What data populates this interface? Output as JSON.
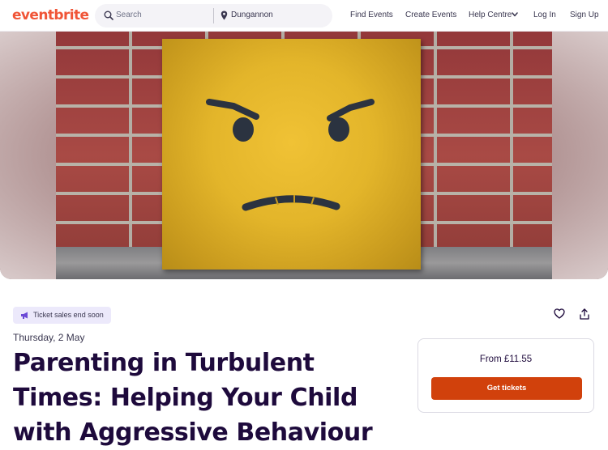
{
  "header": {
    "logo": "eventbrite",
    "search_placeholder": "Search",
    "location": "Dungannon",
    "nav": {
      "find_events": "Find Events",
      "create_events": "Create Events",
      "help_centre": "Help Centre",
      "log_in": "Log In",
      "sign_up": "Sign Up"
    }
  },
  "event": {
    "badge": "Ticket sales end soon",
    "date": "Thursday, 2 May",
    "title": "Parenting in Turbulent Times: Helping Your Child with Aggressive Behaviour"
  },
  "ticket": {
    "price": "From £11.55",
    "button": "Get tickets"
  },
  "colors": {
    "brand": "#f05537",
    "cta": "#d1410c",
    "badge_bg": "#ece9fb",
    "title": "#1e0a3c"
  },
  "icons": [
    "search-icon",
    "location-pin-icon",
    "chevron-down-icon",
    "megaphone-icon",
    "heart-icon",
    "share-icon"
  ]
}
